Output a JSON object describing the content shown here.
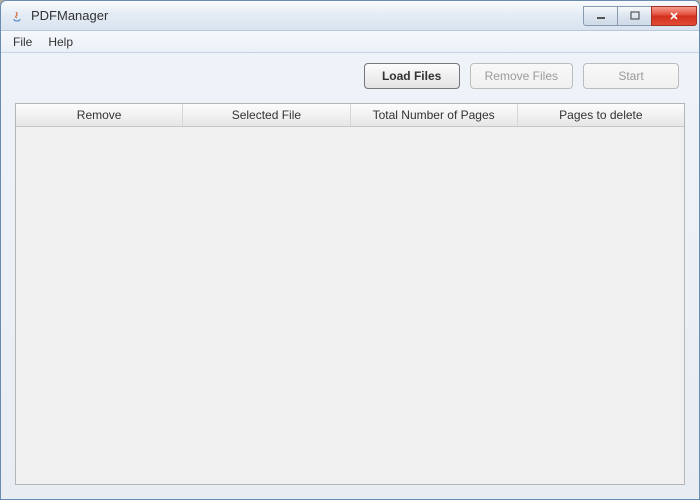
{
  "window": {
    "title": "PDFManager"
  },
  "menubar": {
    "file": "File",
    "help": "Help"
  },
  "toolbar": {
    "load_files": "Load Files",
    "remove_files": "Remove Files",
    "start": "Start"
  },
  "table": {
    "columns": {
      "remove": "Remove",
      "selected_file": "Selected File",
      "total_pages": "Total Number of Pages",
      "pages_to_delete": "Pages to delete"
    },
    "rows": []
  }
}
